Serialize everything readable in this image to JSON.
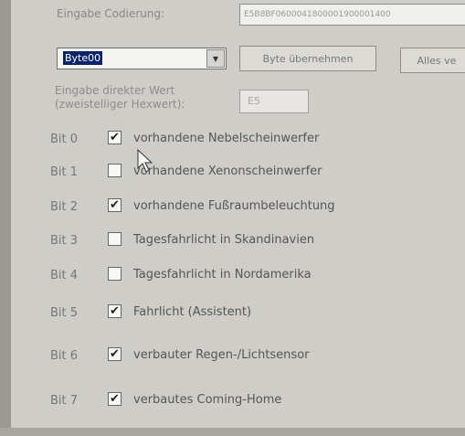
{
  "encoding": {
    "label": "Eingabe Codierung:",
    "value": "E5B8BF0600041800001900001400"
  },
  "byte_select": {
    "selected": "Byte00"
  },
  "buttons": {
    "apply": "Byte übernehmen",
    "all": "Alles ve"
  },
  "direct_value": {
    "label_line1": "Eingabe direkter Wert",
    "label_line2": "(zweistelliger Hexwert):",
    "value": "E5"
  },
  "bits": [
    {
      "bit": "Bit 0",
      "checked": true,
      "label": "vorhandene Nebelscheinwerfer"
    },
    {
      "bit": "Bit 1",
      "checked": false,
      "label": "vorhandene Xenonscheinwerfer"
    },
    {
      "bit": "Bit 2",
      "checked": true,
      "label": "vorhandene Fußraumbeleuchtung"
    },
    {
      "bit": "Bit 3",
      "checked": false,
      "label": "Tagesfahrlicht in Skandinavien"
    },
    {
      "bit": "Bit 4",
      "checked": false,
      "label": "Tagesfahrlicht in Nordamerika"
    },
    {
      "bit": "Bit 5",
      "checked": true,
      "label": "Fahrlicht (Assistent)"
    },
    {
      "bit": "Bit 6",
      "checked": true,
      "label": "verbauter Regen-/Lichtsensor"
    },
    {
      "bit": "Bit 7",
      "checked": true,
      "label": "verbautes Coming-Home"
    }
  ],
  "icons": {
    "dropdown": "chevron-down-icon",
    "checkmark": "check-icon",
    "pointer": "mouse-pointer-icon"
  }
}
